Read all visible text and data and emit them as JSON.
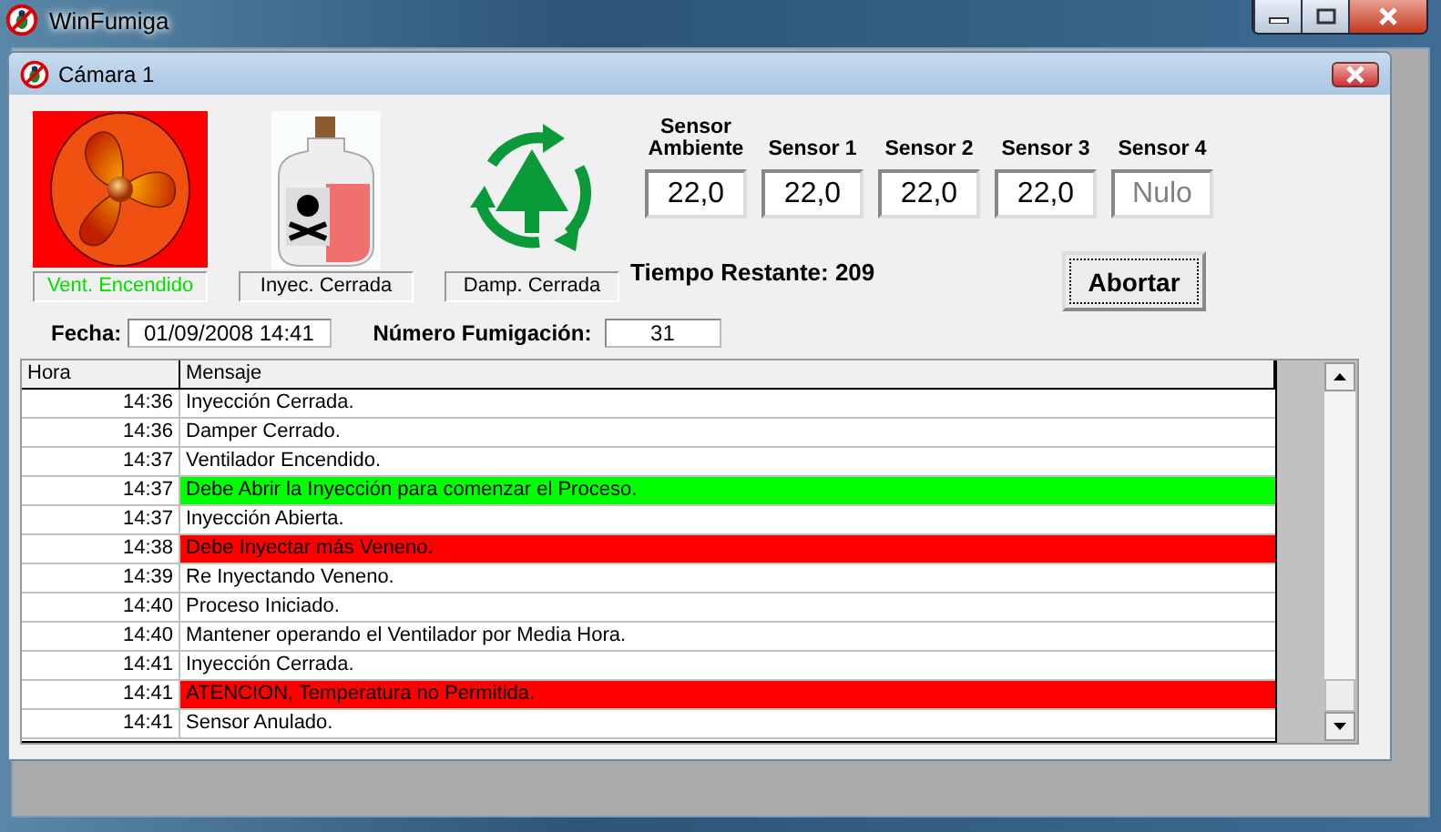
{
  "window": {
    "title": "WinFumiga"
  },
  "child_window": {
    "title": "Cámara 1"
  },
  "devices": [
    {
      "kind": "fan",
      "label": "Vent. Encendido",
      "on": true
    },
    {
      "kind": "bottle",
      "label": "Inyec. Cerrada",
      "on": false
    },
    {
      "kind": "damper",
      "label": "Damp. Cerrada",
      "on": false
    }
  ],
  "sensors": [
    {
      "label": "Sensor Ambiente",
      "value": "22,0",
      "disabled": false
    },
    {
      "label": "Sensor 1",
      "value": "22,0",
      "disabled": false
    },
    {
      "label": "Sensor 2",
      "value": "22,0",
      "disabled": false
    },
    {
      "label": "Sensor 3",
      "value": "22,0",
      "disabled": false
    },
    {
      "label": "Sensor 4",
      "value": "Nulo",
      "disabled": true
    }
  ],
  "remaining_time": "Tiempo Restante: 209",
  "abort_button": "Abortar",
  "date": {
    "label": "Fecha:",
    "value": "01/09/2008 14:41"
  },
  "fumigation_number": {
    "label": "Número Fumigación:",
    "value": "31"
  },
  "log": {
    "columns": [
      "Hora",
      "Mensaje"
    ],
    "rows": [
      {
        "time": "14:36",
        "message": "Inyección Cerrada.",
        "color": "#ffffff"
      },
      {
        "time": "14:36",
        "message": "Damper Cerrado.",
        "color": "#ffffff"
      },
      {
        "time": "14:37",
        "message": "Ventilador Encendido.",
        "color": "#ffffff"
      },
      {
        "time": "14:37",
        "message": "Debe Abrir la Inyección para comenzar el Proceso.",
        "color": "#00ff00"
      },
      {
        "time": "14:37",
        "message": "Inyección Abierta.",
        "color": "#ffffff"
      },
      {
        "time": "14:38",
        "message": "Debe Inyectar más Veneno.",
        "color": "#ff0000"
      },
      {
        "time": "14:39",
        "message": "Re Inyectando Veneno.",
        "color": "#ffffff"
      },
      {
        "time": "14:40",
        "message": "Proceso Iniciado.",
        "color": "#ffffff"
      },
      {
        "time": "14:40",
        "message": "Mantener operando el Ventilador por Media Hora.",
        "color": "#ffffff"
      },
      {
        "time": "14:41",
        "message": "Inyección Cerrada.",
        "color": "#ffffff"
      },
      {
        "time": "14:41",
        "message": "ATENCION, Temperatura no Permitida.",
        "color": "#ff0000"
      },
      {
        "time": "14:41",
        "message": "Sensor Anulado.",
        "color": "#ffffff"
      }
    ]
  }
}
